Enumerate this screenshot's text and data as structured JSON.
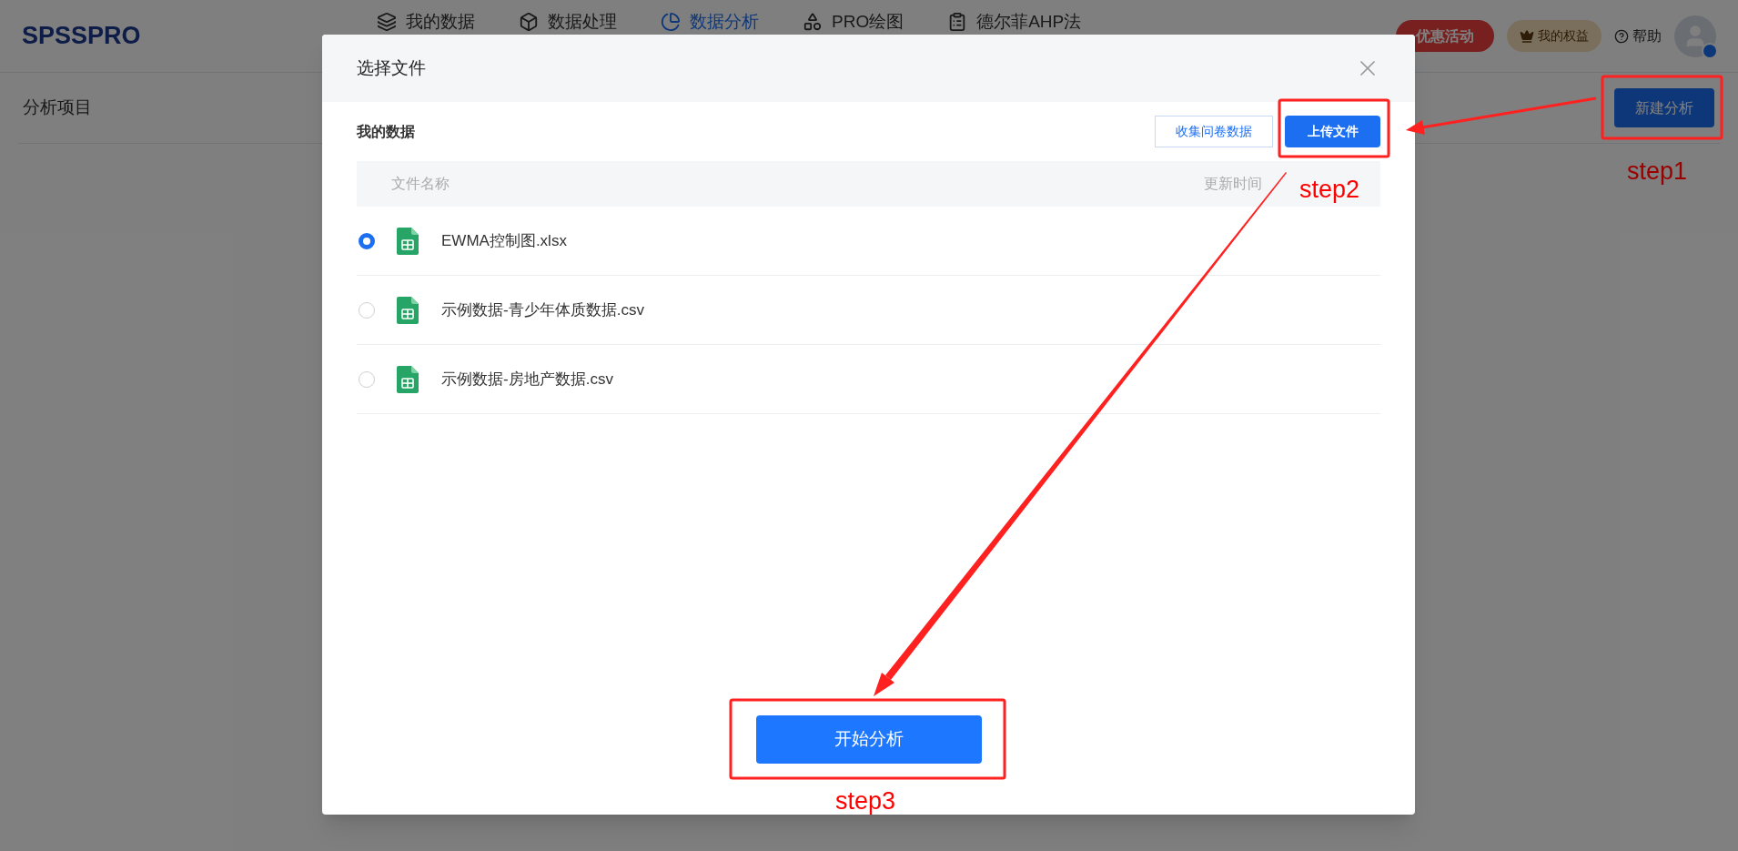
{
  "header": {
    "logo": "SPSSPRO",
    "nav": [
      {
        "label": "我的数据",
        "selected": false
      },
      {
        "label": "数据处理",
        "selected": false
      },
      {
        "label": "数据分析",
        "selected": true
      },
      {
        "label": "PRO绘图",
        "selected": false
      },
      {
        "label": "德尔菲AHP法",
        "selected": false
      }
    ],
    "promo_button": "优惠活动",
    "benefits_button": "我的权益",
    "help_link": "帮助"
  },
  "page": {
    "title": "分析项目",
    "new_button": "新建分析"
  },
  "dialog": {
    "title": "选择文件",
    "section_title": "我的数据",
    "collect_button": "收集问卷数据",
    "upload_button": "上传文件",
    "columns": [
      "文件名称",
      "更新时间"
    ],
    "files": [
      {
        "name": "EWMA控制图.xlsx",
        "selected": true
      },
      {
        "name": "示例数据-青少年体质数据.csv",
        "selected": false
      },
      {
        "name": "示例数据-房地产数据.csv",
        "selected": false
      }
    ],
    "start_button": "开始分析"
  },
  "annotations": [
    {
      "label": "step1"
    },
    {
      "label": "step2"
    },
    {
      "label": "step3"
    }
  ]
}
